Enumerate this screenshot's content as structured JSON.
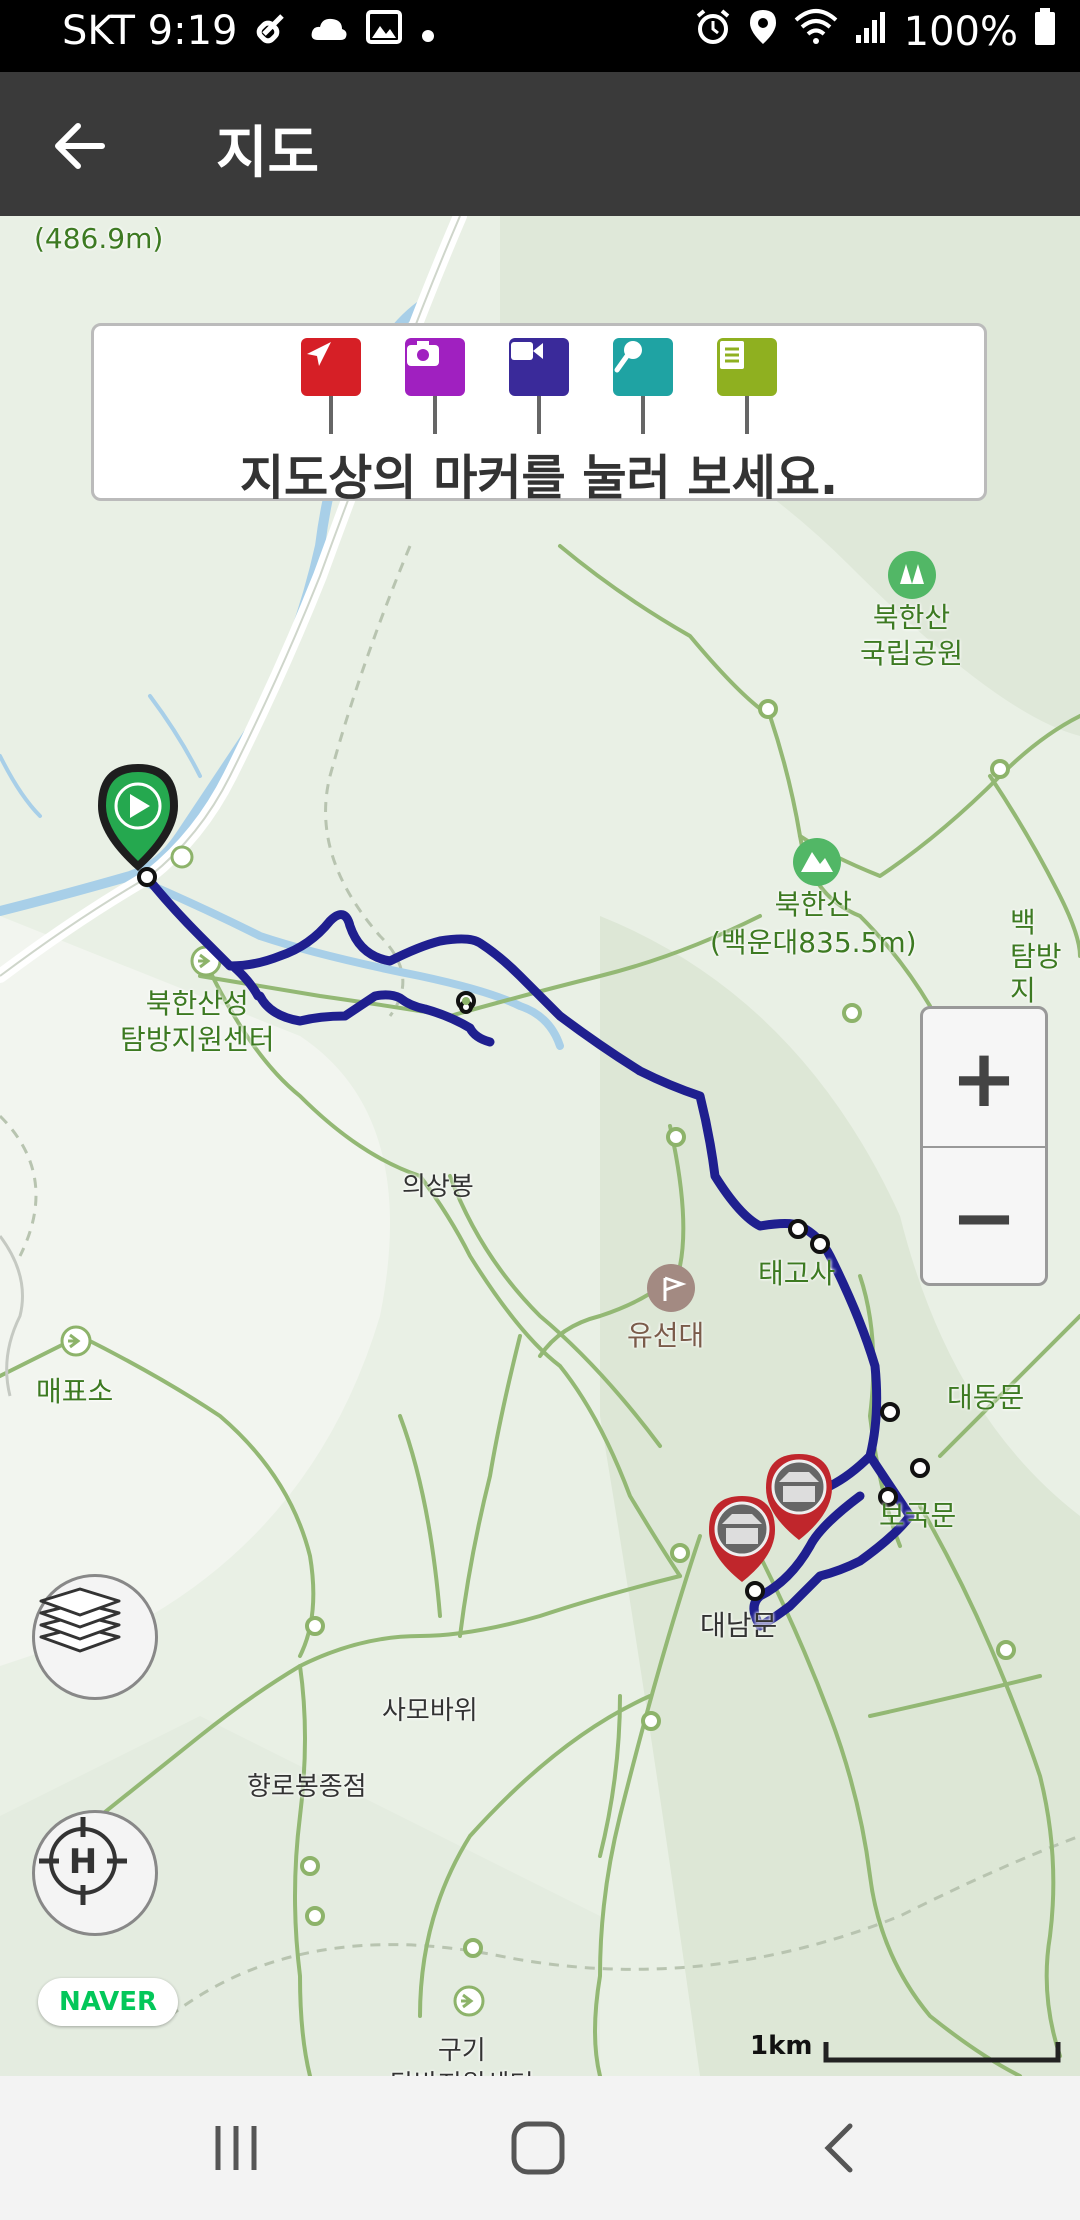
{
  "status_bar": {
    "carrier_time": "SKT 9:19",
    "battery": "100%",
    "left_icons": [
      "link-icon",
      "cloud-icon",
      "image-icon",
      "dot-icon"
    ],
    "right_icons": [
      "alarm-icon",
      "location-icon",
      "wifi-icon",
      "signal-icon",
      "battery-icon"
    ]
  },
  "app_bar": {
    "title": "지도",
    "back_icon": "back-arrow-icon"
  },
  "map": {
    "elevation_top": "(486.9m)",
    "legend": {
      "message": "지도상의 마커를 눌러 보세요.",
      "markers": [
        {
          "name": "navigation-marker",
          "color": "#d61f26"
        },
        {
          "name": "camera-marker",
          "color": "#a020c0"
        },
        {
          "name": "video-marker",
          "color": "#3a2a9a"
        },
        {
          "name": "microphone-marker",
          "color": "#1fa3a3"
        },
        {
          "name": "note-marker",
          "color": "#8fb020"
        }
      ]
    },
    "place_labels": {
      "park": "북한산\n국립공원",
      "peak": "북한산\n(백운대835.5m)",
      "right_edge": "백\n탐방지",
      "visitor_center": "북한산성\n탐방지원센터",
      "uisangbong": "의상봉",
      "taegosa": "태고사",
      "yuseondae": "유선대",
      "maepyoso": "매표소",
      "daedongmun": "대동문",
      "bogukmun": "보국문",
      "daenammun": "대남문",
      "samobawi": "사모바위",
      "hyangrobong": "향로봉종점",
      "gugi": "구기\n탐방지원센터"
    },
    "route_color": "#1f1f8f",
    "trail_color": "#8db36a",
    "controls": {
      "zoom_in": "+",
      "zoom_out": "−",
      "layers_icon": "layers-icon",
      "locate_icon": "crosshair-h-icon"
    },
    "naver_logo": "NAVER",
    "scale_label": "1km"
  },
  "nav_bar": {
    "recent_icon": "recent-apps-icon",
    "home_icon": "home-icon",
    "back_icon": "back-chevron-icon"
  }
}
